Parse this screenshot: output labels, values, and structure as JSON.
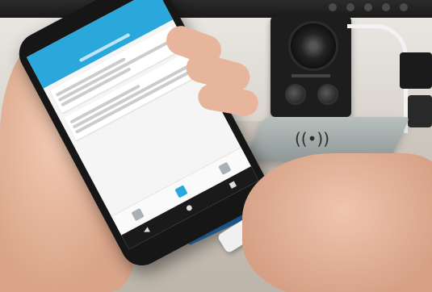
{
  "scene": {
    "description_tags": [
      "hand-holding-phone",
      "wireless-charger",
      "speaker",
      "usb-cable"
    ],
    "colors": {
      "app_accent": "#2aa8dc",
      "phone_body": "#161616",
      "desk": "#c7c0b6",
      "wall": "#e6e2dc"
    }
  },
  "icons": {
    "wireless_symbol": "((•))",
    "back": "◀",
    "home": "●",
    "recent": "■"
  }
}
